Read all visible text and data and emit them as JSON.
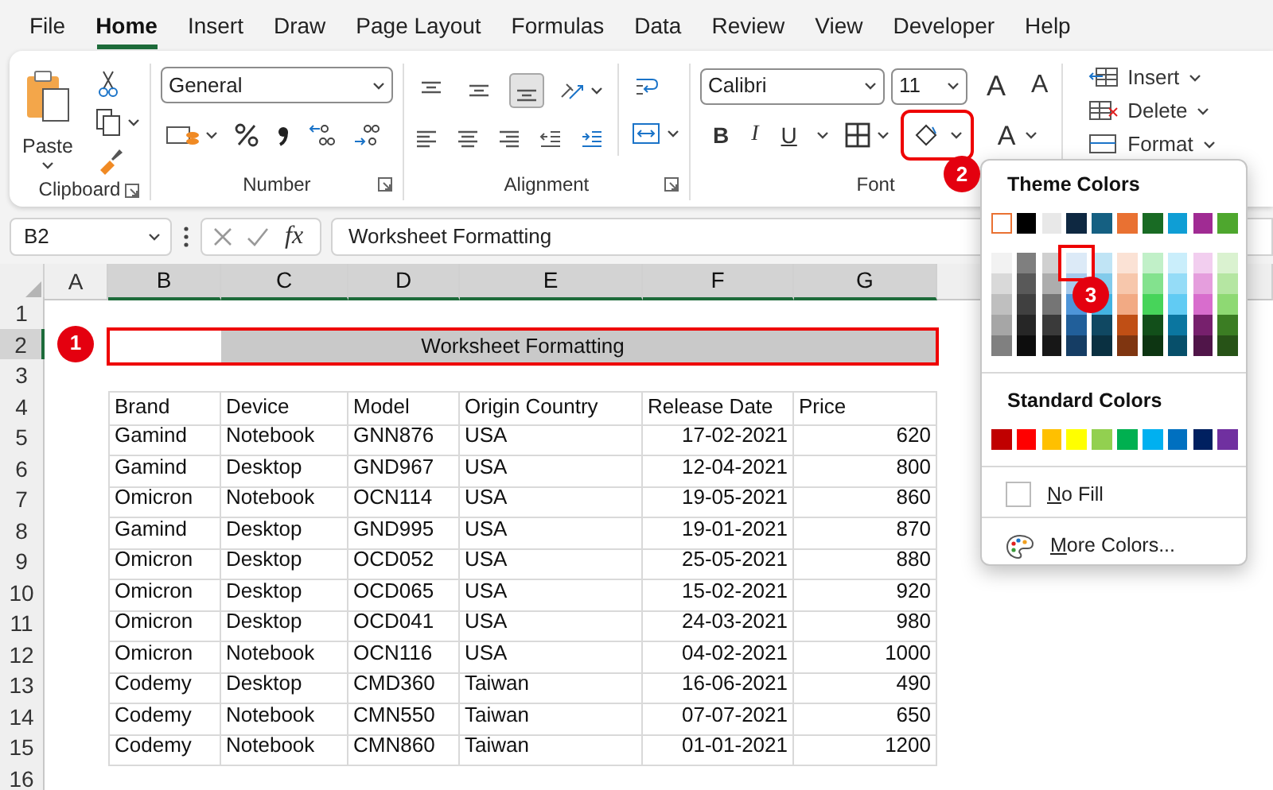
{
  "menu_tabs": [
    {
      "label": "File",
      "selected": false
    },
    {
      "label": "Home",
      "selected": true
    },
    {
      "label": "Insert",
      "selected": false
    },
    {
      "label": "Draw",
      "selected": false
    },
    {
      "label": "Page Layout",
      "selected": false
    },
    {
      "label": "Formulas",
      "selected": false
    },
    {
      "label": "Data",
      "selected": false
    },
    {
      "label": "Review",
      "selected": false
    },
    {
      "label": "View",
      "selected": false
    },
    {
      "label": "Developer",
      "selected": false
    },
    {
      "label": "Help",
      "selected": false
    }
  ],
  "ribbon": {
    "groups": [
      {
        "kind": "clipboard",
        "label": "Clipboard",
        "launcher": true,
        "paste_label": "Paste"
      },
      {
        "kind": "number",
        "label": "Number",
        "launcher": true,
        "format": "General"
      },
      {
        "kind": "alignment",
        "label": "Alignment",
        "launcher": true,
        "align_buttons": [
          {
            "kind": "top",
            "selected": false
          },
          {
            "kind": "middle",
            "selected": false
          },
          {
            "kind": "bottom",
            "selected": true
          }
        ]
      },
      {
        "kind": "font",
        "label": "Font",
        "font_name": "Calibri",
        "font_size": "11",
        "grow_label": "A",
        "shrink_label": "A",
        "style_buttons": [
          {
            "kind": "bold",
            "label": "B"
          },
          {
            "kind": "italic",
            "label": "I"
          },
          {
            "kind": "underline",
            "label": "U"
          }
        ],
        "fill_highlighted": true,
        "fill_badge": "2",
        "font_color_label": "A"
      },
      {
        "kind": "cells",
        "buttons": [
          {
            "kind": "insert",
            "label": "Insert"
          },
          {
            "kind": "delete",
            "label": "Delete"
          },
          {
            "kind": "format",
            "label": "Format"
          }
        ]
      }
    ]
  },
  "formula_bar": {
    "name_box": "B2",
    "function_label": "fx",
    "formula": "Worksheet Formatting"
  },
  "sheet": {
    "columns": [
      {
        "label": "A",
        "selected": false
      },
      {
        "label": "B",
        "selected": true
      },
      {
        "label": "C",
        "selected": true
      },
      {
        "label": "D",
        "selected": true
      },
      {
        "label": "E",
        "selected": true
      },
      {
        "label": "F",
        "selected": true
      },
      {
        "label": "G",
        "selected": true
      }
    ],
    "rows": [
      {
        "header": "1",
        "selected": false,
        "kind": "empty"
      },
      {
        "header": "2",
        "selected": true,
        "kind": "title",
        "title": "Worksheet Formatting",
        "highlighted": true,
        "badge": "1"
      },
      {
        "header": "3",
        "selected": false,
        "kind": "empty"
      },
      {
        "header": "4",
        "selected": false,
        "kind": "header",
        "cells": [
          "Brand",
          "Device",
          "Model",
          "Origin Country",
          "Release Date",
          "Price"
        ]
      },
      {
        "header": "5",
        "selected": false,
        "kind": "data",
        "cells": [
          "Gamind",
          "Notebook",
          "GNN876",
          "USA",
          "17-02-2021",
          "620"
        ]
      },
      {
        "header": "6",
        "selected": false,
        "kind": "data",
        "cells": [
          "Gamind",
          "Desktop",
          "GND967",
          "USA",
          "12-04-2021",
          "800"
        ]
      },
      {
        "header": "7",
        "selected": false,
        "kind": "data",
        "cells": [
          "Omicron",
          "Notebook",
          "OCN114",
          "USA",
          "19-05-2021",
          "860"
        ]
      },
      {
        "header": "8",
        "selected": false,
        "kind": "data",
        "cells": [
          "Gamind",
          "Desktop",
          "GND995",
          "USA",
          "19-01-2021",
          "870"
        ]
      },
      {
        "header": "9",
        "selected": false,
        "kind": "data",
        "cells": [
          "Omicron",
          "Desktop",
          "OCD052",
          "USA",
          "25-05-2021",
          "880"
        ]
      },
      {
        "header": "10",
        "selected": false,
        "kind": "data",
        "cells": [
          "Omicron",
          "Desktop",
          "OCD065",
          "USA",
          "15-02-2021",
          "920"
        ]
      },
      {
        "header": "11",
        "selected": false,
        "kind": "data",
        "cells": [
          "Omicron",
          "Desktop",
          "OCD041",
          "USA",
          "24-03-2021",
          "980"
        ]
      },
      {
        "header": "12",
        "selected": false,
        "kind": "data",
        "cells": [
          "Omicron",
          "Notebook",
          "OCN116",
          "USA",
          "04-02-2021",
          "1000"
        ]
      },
      {
        "header": "13",
        "selected": false,
        "kind": "data",
        "cells": [
          "Codemy",
          "Desktop",
          "CMD360",
          "Taiwan",
          "16-06-2021",
          "490"
        ]
      },
      {
        "header": "14",
        "selected": false,
        "kind": "data",
        "cells": [
          "Codemy",
          "Notebook",
          "CMN550",
          "Taiwan",
          "07-07-2021",
          "650"
        ]
      },
      {
        "header": "15",
        "selected": false,
        "kind": "data",
        "cells": [
          "Codemy",
          "Notebook",
          "CMN860",
          "Taiwan",
          "01-01-2021",
          "1200"
        ]
      },
      {
        "header": "16",
        "selected": false,
        "kind": "empty"
      }
    ]
  },
  "palette": {
    "title": "Theme Colors",
    "badge": "3",
    "theme": [
      {
        "color": "#ffffff",
        "selected": true
      },
      {
        "color": "#000000",
        "selected": false
      },
      {
        "color": "#e8e8e8",
        "selected": false
      },
      {
        "color": "#0e2841",
        "selected": false
      },
      {
        "color": "#156082",
        "selected": false
      },
      {
        "color": "#e97132",
        "selected": false
      },
      {
        "color": "#196b24",
        "selected": false
      },
      {
        "color": "#0f9ed5",
        "selected": false
      },
      {
        "color": "#a02b93",
        "selected": false
      },
      {
        "color": "#4ea72e",
        "selected": false
      }
    ],
    "shade_rows": [
      {
        "swatches": [
          {
            "color": "#f2f2f2",
            "highlighted": false
          },
          {
            "color": "#7f7f7f",
            "highlighted": false
          },
          {
            "color": "#d0d0d0",
            "highlighted": false
          },
          {
            "color": "#dceaf7",
            "highlighted": true
          },
          {
            "color": "#c0e4f5",
            "highlighted": false
          },
          {
            "color": "#fbe2d5",
            "highlighted": false
          },
          {
            "color": "#c1f0c8",
            "highlighted": false
          },
          {
            "color": "#caeefb",
            "highlighted": false
          },
          {
            "color": "#f2ceef",
            "highlighted": false
          },
          {
            "color": "#daf2d0",
            "highlighted": false
          }
        ]
      },
      {
        "swatches": [
          {
            "color": "#d9d9d9",
            "highlighted": false
          },
          {
            "color": "#595959",
            "highlighted": false
          },
          {
            "color": "#adadad",
            "highlighted": false
          },
          {
            "color": "#a6caec",
            "highlighted": false
          },
          {
            "color": "#83cbeb",
            "highlighted": false
          },
          {
            "color": "#f7c7ac",
            "highlighted": false
          },
          {
            "color": "#83e28e",
            "highlighted": false
          },
          {
            "color": "#95dcf7",
            "highlighted": false
          },
          {
            "color": "#e59edd",
            "highlighted": false
          },
          {
            "color": "#b5e6a2",
            "highlighted": false
          }
        ]
      },
      {
        "swatches": [
          {
            "color": "#bfbfbf",
            "highlighted": false
          },
          {
            "color": "#404040",
            "highlighted": false
          },
          {
            "color": "#757575",
            "highlighted": false
          },
          {
            "color": "#4e95d9",
            "highlighted": false
          },
          {
            "color": "#44b3e1",
            "highlighted": false
          },
          {
            "color": "#f2aa84",
            "highlighted": false
          },
          {
            "color": "#47d45a",
            "highlighted": false
          },
          {
            "color": "#61cbf3",
            "highlighted": false
          },
          {
            "color": "#d86dcd",
            "highlighted": false
          },
          {
            "color": "#8ed973",
            "highlighted": false
          }
        ]
      },
      {
        "swatches": [
          {
            "color": "#a6a6a6",
            "highlighted": false
          },
          {
            "color": "#262626",
            "highlighted": false
          },
          {
            "color": "#3a3a3a",
            "highlighted": false
          },
          {
            "color": "#215f9a",
            "highlighted": false
          },
          {
            "color": "#104862",
            "highlighted": false
          },
          {
            "color": "#c04f15",
            "highlighted": false
          },
          {
            "color": "#124f1a",
            "highlighted": false
          },
          {
            "color": "#0b76a0",
            "highlighted": false
          },
          {
            "color": "#77206d",
            "highlighted": false
          },
          {
            "color": "#3b7d23",
            "highlighted": false
          }
        ]
      },
      {
        "swatches": [
          {
            "color": "#808080",
            "highlighted": false
          },
          {
            "color": "#0d0d0d",
            "highlighted": false
          },
          {
            "color": "#171717",
            "highlighted": false
          },
          {
            "color": "#153d64",
            "highlighted": false
          },
          {
            "color": "#0a3041",
            "highlighted": false
          },
          {
            "color": "#7f3510",
            "highlighted": false
          },
          {
            "color": "#0d3512",
            "highlighted": false
          },
          {
            "color": "#074f6a",
            "highlighted": false
          },
          {
            "color": "#501549",
            "highlighted": false
          },
          {
            "color": "#275317",
            "highlighted": false
          }
        ]
      }
    ],
    "standard_title": "Standard Colors",
    "standard": [
      {
        "color": "#c00000"
      },
      {
        "color": "#ff0000"
      },
      {
        "color": "#ffc000"
      },
      {
        "color": "#ffff00"
      },
      {
        "color": "#92d050"
      },
      {
        "color": "#00b050"
      },
      {
        "color": "#00b0f0"
      },
      {
        "color": "#0070c0"
      },
      {
        "color": "#002060"
      },
      {
        "color": "#7030a0"
      }
    ],
    "no_fill": "No Fill",
    "more_colors": "More Colors..."
  }
}
